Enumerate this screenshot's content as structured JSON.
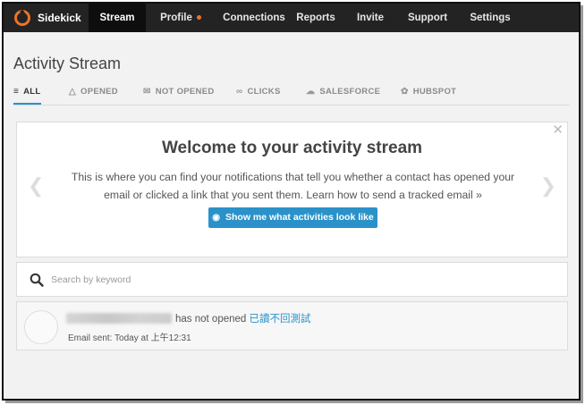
{
  "nav": {
    "brand": "Sidekick",
    "items": [
      {
        "label": "Stream",
        "active": true
      },
      {
        "label": "Profile",
        "active": false,
        "badge_dot": true
      },
      {
        "label": "Connections",
        "active": false
      },
      {
        "label": "Reports",
        "active": false
      },
      {
        "label": "Invite",
        "active": false
      },
      {
        "label": "Support",
        "active": false
      },
      {
        "label": "Settings",
        "active": false
      }
    ]
  },
  "page": {
    "title": "Activity Stream"
  },
  "tabs": [
    {
      "label": "ALL",
      "icon": "list-icon",
      "active": true
    },
    {
      "label": "OPENED",
      "icon": "envelope-open-icon",
      "active": false
    },
    {
      "label": "NOT OPENED",
      "icon": "envelope-icon",
      "active": false
    },
    {
      "label": "CLICKS",
      "icon": "link-icon",
      "active": false
    },
    {
      "label": "SALESFORCE",
      "icon": "cloud-icon",
      "active": false
    },
    {
      "label": "HUBSPOT",
      "icon": "hubspot-icon",
      "active": false
    }
  ],
  "welcome": {
    "title": "Welcome to your activity stream",
    "text": "This is where you can find your notifications that tell you whether a contact has opened your email or clicked a link that you sent them. Learn how to send a tracked email »",
    "button_label": "Show me what activities look like"
  },
  "search": {
    "placeholder": "Search by keyword",
    "value": ""
  },
  "activity": {
    "status_text": "has not opened",
    "subject": "已讀不回測試",
    "sent_line": "Email sent: Today at 上午12:31"
  },
  "colors": {
    "nav_bg": "#232323",
    "accent": "#2a92c9",
    "brand": "#e8742a"
  }
}
